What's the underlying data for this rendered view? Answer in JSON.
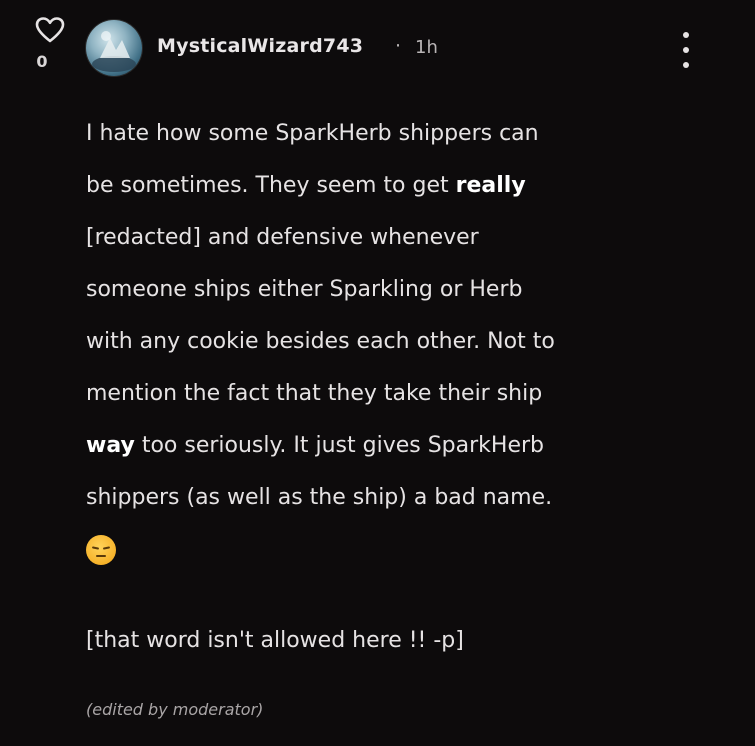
{
  "post": {
    "like_icon": "heart-outline-icon",
    "like_count": "0",
    "username": "MysticalWizard743",
    "separator": "·",
    "timestamp": "1h",
    "menu_icon": "kebab-menu-icon",
    "body_lines": [
      [
        "I hate how some SparkHerb shippers can"
      ],
      [
        "be sometimes. They seem to get ",
        "really"
      ],
      [
        "[redacted] and defensive whenever"
      ],
      [
        "someone  ships either Sparkling or Herb"
      ],
      [
        "with any cookie besides each other. Not to"
      ],
      [
        "mention the fact that they take their ship"
      ],
      [
        "way",
        " too seriously. It just gives SparkHerb"
      ],
      [
        "shippers (as well as the ship) a bad name."
      ]
    ],
    "emoji": "pensive-face-emoji",
    "moderator_note": "[that word isn't allowed here !! -p]",
    "edited_note": "(edited by moderator)"
  },
  "colors": {
    "background": "#0d0b0c",
    "text": "#e6e3e4",
    "muted": "#b9b5b6"
  }
}
